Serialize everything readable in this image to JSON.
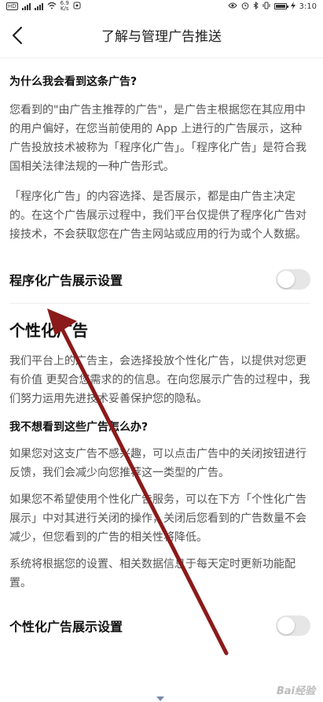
{
  "status": {
    "carrier": "HD",
    "speed_value": "6.9",
    "speed_unit": "K/s",
    "time": "3:10"
  },
  "nav": {
    "title": "了解与管理广告推送"
  },
  "why": {
    "title": "为什么我会看到这条广告?",
    "para1": "您看到的\"由广告主推荐的广告\"，是广告主根据您在其应用中的用户偏好，在您当前使用的 App 上进行的广告展示，这种广告投放技术被称为「程序化广告」。「程序化广告」是符合我国相关法律法规的一种广告形式。",
    "para2": "「程序化广告」的内容选择、是否展示，都是由广告主决定的。在这个广告展示过程中，我们平台仅提供了程序化广告对接技术，不会获取您在广告主网站或应用的行为或个人数据。"
  },
  "programmatic_setting": {
    "label": "程序化广告展示设置",
    "enabled": false
  },
  "personalized": {
    "title": "个性化广告",
    "para1": "我们平台上的广告主，会选择投放个性化广告，以提供对您更有价值 更契合您需求的的信息。在向您展示广告的过程中，我们努力运用先进技术妥善保护您的隐私。",
    "dont_want_title": "我不想看到这些广告怎么办?",
    "para2": "如果您对这支广告不感兴趣，可以点击广告中的关闭按钮进行反馈，我们会减少向您推荐这一类型的广告。",
    "para3": "如果您不希望使用个性化广告服务，可以在下方「个性化广告展示」中对其进行关闭的操作，关闭后您看到的广告数量不会减少，但您看到的广告的相关性将降低。",
    "para4": "系统将根据您的设置、相关数据信息于每天定时更新功能配置。"
  },
  "personalized_setting": {
    "label": "个性化广告展示设置",
    "enabled": false
  },
  "watermark": "Bai经验",
  "colors": {
    "arrow": "#8b1a1a",
    "toggle_off": "#e6e6e6"
  }
}
